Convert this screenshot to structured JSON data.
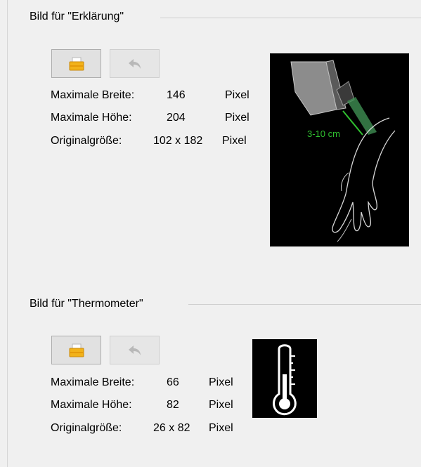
{
  "groups": [
    {
      "title": "Bild für \"Erklärung\"",
      "open_icon": "folder-open-icon",
      "undo_icon": "undo-arrow-icon",
      "max_width_label": "Maximale Breite:",
      "max_width_value": "146",
      "max_height_label": "Maximale Höhe:",
      "max_height_value": "204",
      "original_label": "Originalgröße:",
      "original_value": "102 x 182",
      "unit": "Pixel",
      "preview_annotation": "3-10 cm"
    },
    {
      "title": "Bild für \"Thermometer\"",
      "open_icon": "folder-open-icon",
      "undo_icon": "undo-arrow-icon",
      "max_width_label": "Maximale Breite:",
      "max_width_value": "66",
      "max_height_label": "Maximale Höhe:",
      "max_height_value": "82",
      "original_label": "Originalgröße:",
      "original_value": "26 x 82",
      "unit": "Pixel"
    }
  ],
  "colors": {
    "background": "#f0f0f0",
    "preview_background": "#000000",
    "annotation_green": "#2fbf2f"
  }
}
